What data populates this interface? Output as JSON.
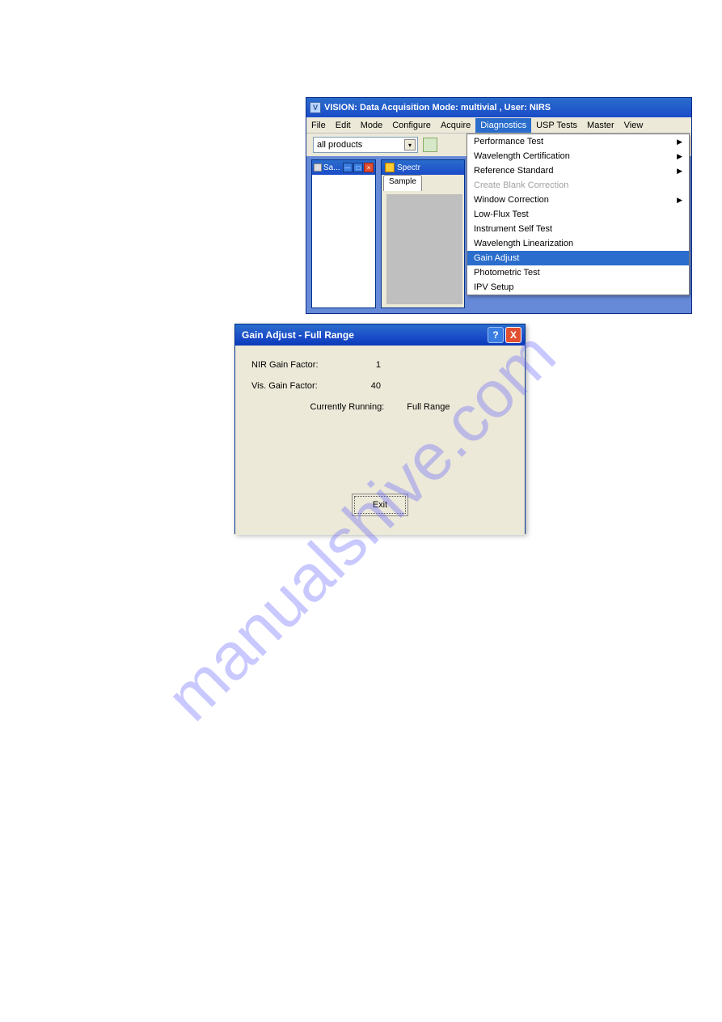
{
  "watermark": "manualshive.com",
  "vision": {
    "title": "VISION: Data Acquisition Mode: multivial , User: NIRS",
    "logo_letter": "V",
    "menubar": [
      "File",
      "Edit",
      "Mode",
      "Configure",
      "Acquire",
      "Diagnostics",
      "USP Tests",
      "Master",
      "View"
    ],
    "active_menu_index": 5,
    "combo_value": "all products",
    "child_windows": {
      "sa_title": "Sa...",
      "spectr_title": "Spectr",
      "spectr_tab": "Sample"
    },
    "dropdown": [
      {
        "label": "Performance Test",
        "submenu": true,
        "disabled": false,
        "highlight": false
      },
      {
        "label": "Wavelength Certification",
        "submenu": true,
        "disabled": false,
        "highlight": false
      },
      {
        "label": "Reference Standard",
        "submenu": true,
        "disabled": false,
        "highlight": false
      },
      {
        "label": "Create Blank Correction",
        "submenu": false,
        "disabled": true,
        "highlight": false
      },
      {
        "label": "Window Correction",
        "submenu": true,
        "disabled": false,
        "highlight": false
      },
      {
        "label": "Low-Flux Test",
        "submenu": false,
        "disabled": false,
        "highlight": false
      },
      {
        "label": "Instrument Self Test",
        "submenu": false,
        "disabled": false,
        "highlight": false
      },
      {
        "label": "Wavelength Linearization",
        "submenu": false,
        "disabled": false,
        "highlight": false
      },
      {
        "label": "Gain Adjust",
        "submenu": false,
        "disabled": false,
        "highlight": true
      },
      {
        "label": "Photometric Test",
        "submenu": false,
        "disabled": false,
        "highlight": false
      },
      {
        "label": "IPV Setup",
        "submenu": false,
        "disabled": false,
        "highlight": false
      }
    ]
  },
  "gain_dialog": {
    "title": "Gain Adjust - Full Range",
    "help_symbol": "?",
    "close_symbol": "X",
    "rows": {
      "nir_label": "NIR Gain Factor:",
      "nir_value": "1",
      "vis_label": "Vis. Gain Factor:",
      "vis_value": "40",
      "running_label": "Currently Running:",
      "running_value": "Full Range"
    },
    "exit_label": "Exit"
  }
}
